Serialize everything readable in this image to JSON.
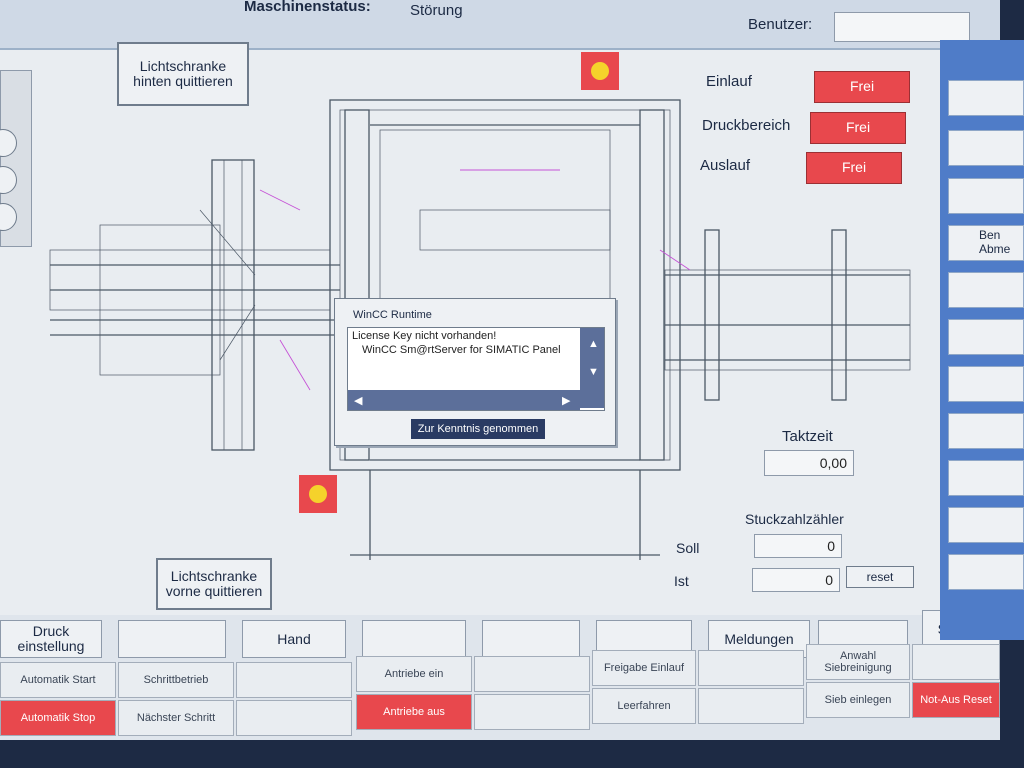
{
  "header": {
    "status_label": "Maschinenstatus:",
    "status_value": "Störung",
    "user_label": "Benutzer:"
  },
  "buttons": {
    "ls_hinten": "Lichtschranke hinten quittieren",
    "ls_vorne": "Lichtschranke vorne quittieren",
    "reset": "reset"
  },
  "zones": [
    {
      "label": "Einlauf",
      "value": "Frei"
    },
    {
      "label": "Druckbereich",
      "value": "Frei"
    },
    {
      "label": "Auslauf",
      "value": "Frei"
    }
  ],
  "takt": {
    "label": "Taktzeit",
    "value": "0,00"
  },
  "counter": {
    "title": "Stuckzahlzähler",
    "soll_label": "Soll",
    "soll_value": "0",
    "ist_label": "Ist",
    "ist_value": "0"
  },
  "right_panel": {
    "item": "Ben Abme"
  },
  "dialog": {
    "title": "WinCC Runtime",
    "line1": "License Key nicht vorhanden!",
    "line2": "WinCC Sm@rtServer for SIMATIC Panel",
    "button": "Zur Kenntnis genommen"
  },
  "nav_row1": [
    "Druck einstellung",
    "",
    "Hand",
    "",
    "",
    "",
    "Meldungen",
    "",
    "Service"
  ],
  "nav_row2": [
    "Automatik Start",
    "Schrittbetrieb",
    "",
    "Antriebe ein",
    "",
    "Freigabe Einlauf",
    "",
    "Anwahl Siebreinigung",
    ""
  ],
  "nav_row3": [
    "Automatik Stop",
    "Nächster Schritt",
    "",
    "Antriebe aus",
    "",
    "Leerfahren",
    "",
    "Sieb einlegen",
    "Not-Aus Reset"
  ],
  "colors": {
    "alarm_red": "#e8484d",
    "lamp_yellow": "#f5d22b",
    "panel_blue": "#4f7cc8"
  }
}
